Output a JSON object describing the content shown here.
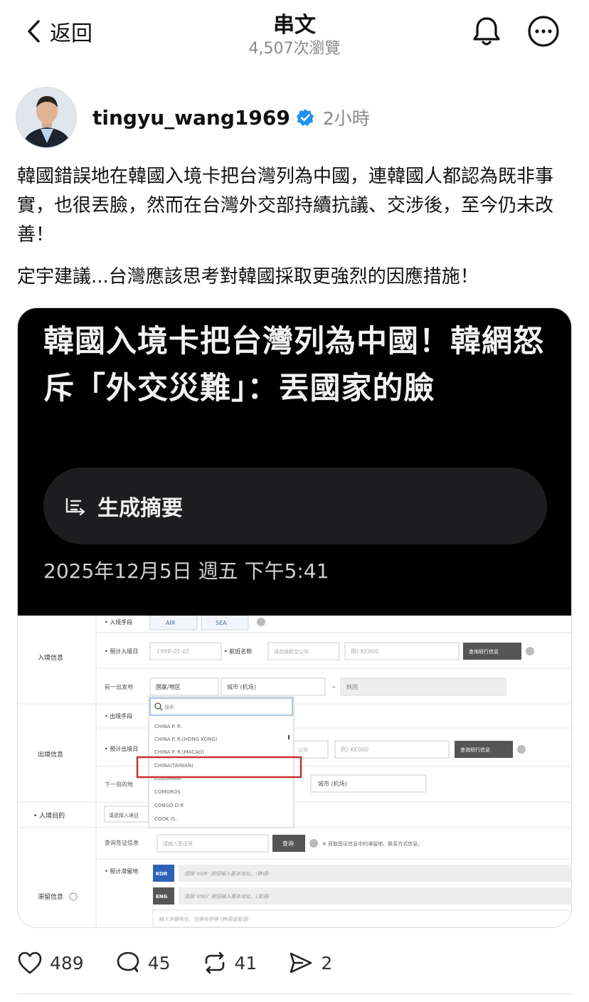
{
  "header": {
    "back_label": "返回",
    "title": "串文",
    "views": "4,507次瀏覽"
  },
  "post": {
    "username": "tingyu_wang1969",
    "time": "2小時",
    "paragraphs": [
      "韓國錯誤地在韓國入境卡把台灣列為中國，連韓國人都認為既非事實，也很丟臉，然而在台灣外交部持續抗議、交涉後，至今仍未改善！",
      "定宇建議...台灣應該思考對韓國採取更強烈的因應措施！"
    ]
  },
  "card": {
    "title": "韓國入境卡把台灣列為中國！韓網怒斥「外交災難」：丟國家的臉",
    "summary_label": "生成摘要",
    "date": "2025年12月5日 週五 下午5:41"
  },
  "form": {
    "section_entry": "入境信息",
    "section_exit": "出境信息",
    "section_purpose": "• 入境目的",
    "section_stay": "滞留信息",
    "row_entry_method": "• 入境手段",
    "btn_air": "AIR",
    "btn_sea": "SEA",
    "row_entry_date": "• 预计入境日",
    "entry_date_placeholder": "1999-01-01",
    "row_flight": "• 航班名称",
    "flight_select": "请选择航空公司",
    "flight_no": "例) KE000",
    "query_btn": "查询班行信息",
    "row_depart": "前一出发地",
    "country_select": "国家/地区",
    "city_select": "城市 (机场)",
    "arrow": "→",
    "dest": "韩国",
    "search_placeholder": "搜索",
    "dropdown": [
      "CHINA P. R.",
      "CHINA P. R.(HONG KONG)",
      "CHINA P. R.(MACAO)",
      "CHINA(TAIWAN)",
      "COLOMBIA",
      "COMOROS",
      "CONGO D.R",
      "COOK IS."
    ],
    "row_exit_method": "• 出境手段",
    "row_exit_date": "• 预计出境日",
    "exit_flight_select": "公司",
    "exit_flight_no": "例) KE000",
    "row_next": "下一目的地",
    "exit_city_select": "城市 (机场)",
    "purpose_select": "请选择入境目",
    "row_visa": "查询签证信息",
    "visa_placeholder": "请输入签证号",
    "visa_btn": "查询",
    "visa_note": "※ 获取签证信息中的滞留地、联系方式信息。",
    "row_address": "• 预计滞留地",
    "kor": "KOR",
    "eng": "ENG",
    "kor_placeholder": "请按 'KOR' 按钮输入基本地址。(韩语)",
    "eng_placeholder": "请按 'ENG' 按钮输入基本地址。(英语)",
    "detail_placeholder": "输入详细地址。住宿名称等 (韩语或英语)"
  },
  "actions": {
    "likes": "489",
    "comments": "45",
    "reposts": "41",
    "shares": "2"
  }
}
